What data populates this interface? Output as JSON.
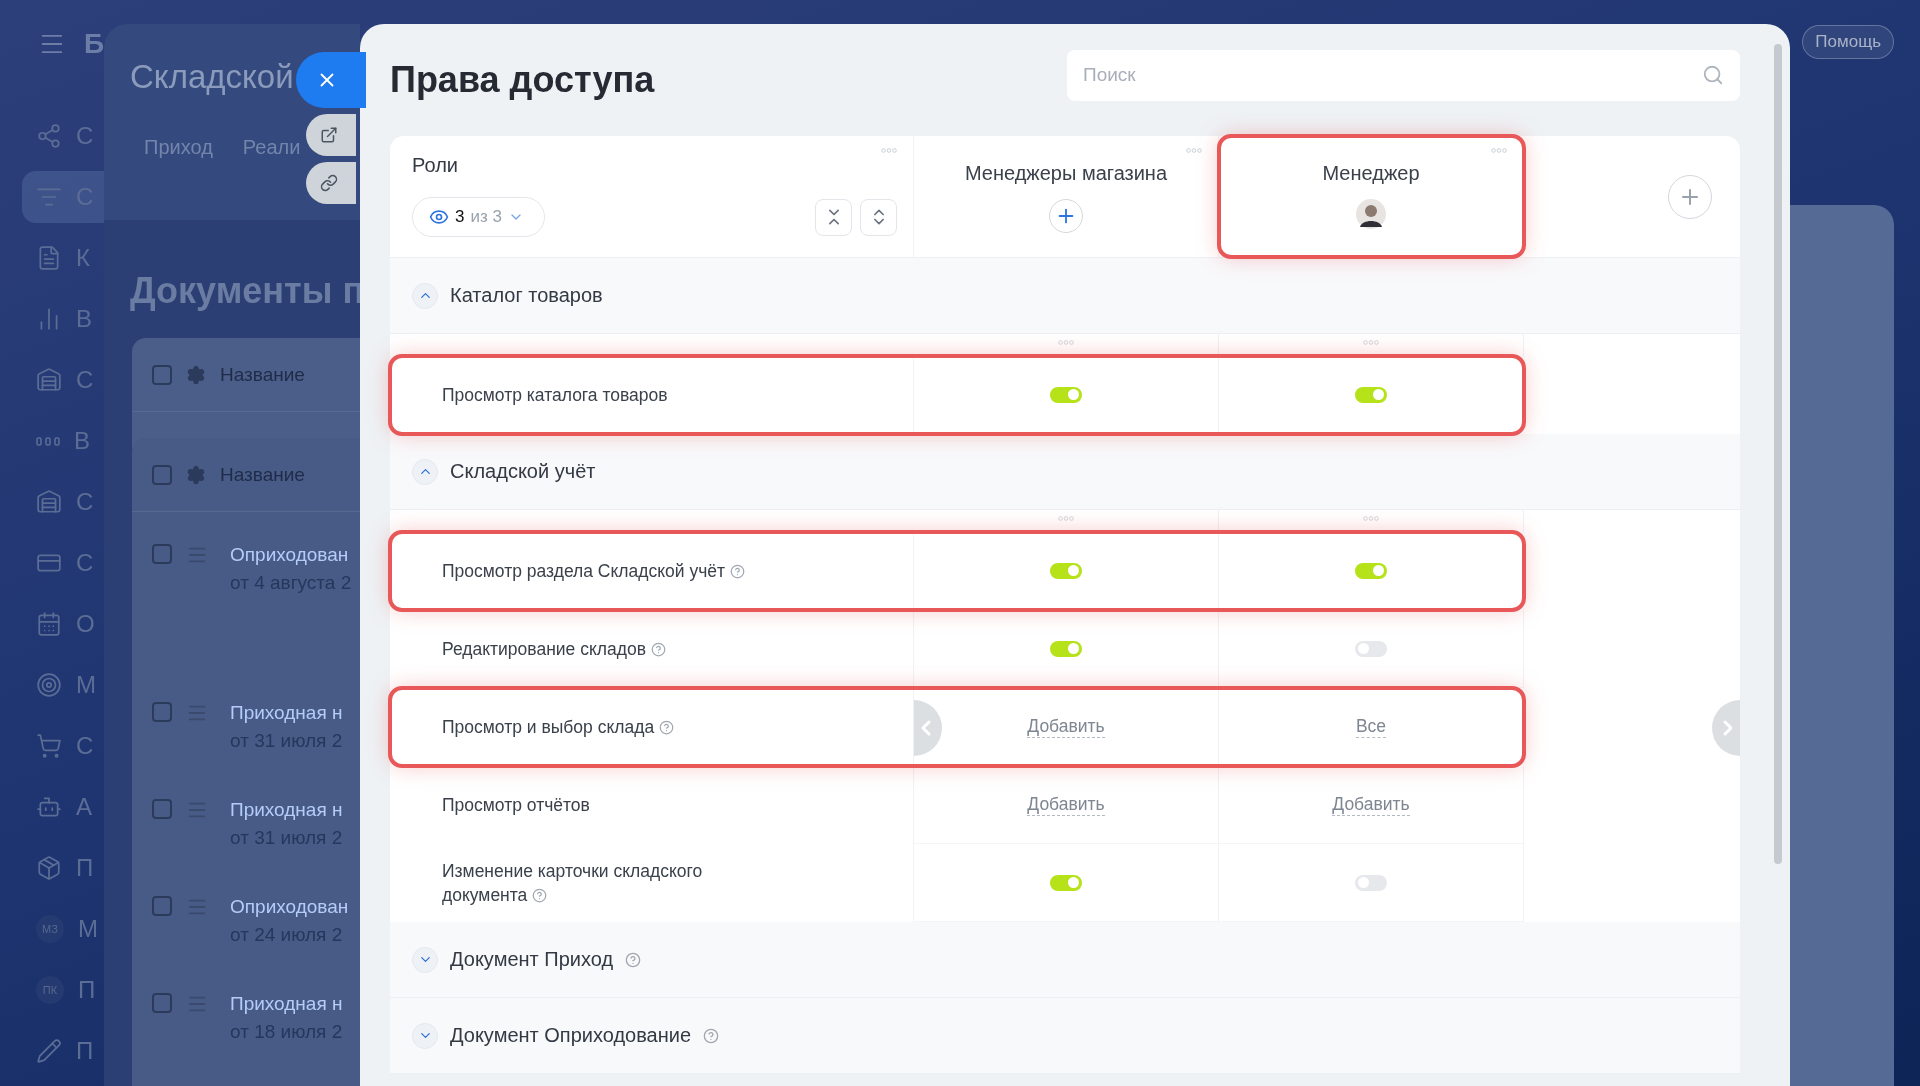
{
  "sidebar": {
    "brand": "Б",
    "items": [
      {
        "kind": "share",
        "label": "С",
        "selected": false
      },
      {
        "kind": "filter",
        "label": "С",
        "selected": true
      },
      {
        "kind": "doc",
        "label": "К",
        "selected": false
      },
      {
        "kind": "chart",
        "label": "В",
        "selected": false
      },
      {
        "kind": "warehouse",
        "label": "С",
        "selected": false
      },
      {
        "kind": "dots",
        "label": "В",
        "selected": false
      },
      {
        "kind": "warehouse",
        "label": "С",
        "selected": false
      },
      {
        "kind": "card",
        "label": "С",
        "selected": false
      },
      {
        "kind": "calendar",
        "label": "О",
        "selected": false
      },
      {
        "kind": "target",
        "label": "М",
        "selected": false
      },
      {
        "kind": "cart",
        "label": "С",
        "selected": false
      },
      {
        "kind": "robot",
        "label": "А",
        "selected": false
      },
      {
        "kind": "box",
        "label": "П",
        "selected": false
      },
      {
        "kind": "avatar",
        "initials": "МЗ",
        "label": "М",
        "selected": false
      },
      {
        "kind": "avatar",
        "initials": "ПК",
        "label": "П",
        "selected": false
      },
      {
        "kind": "pencil",
        "label": "П",
        "selected": false
      }
    ]
  },
  "background_panel": {
    "title": "Складской",
    "tabs": [
      "Приход",
      "Реали"
    ],
    "heading": "Документы п",
    "tables": [
      {
        "header": "Название",
        "all_checked": false
      },
      {
        "header": "Название",
        "all_checked": false,
        "rows": [
          {
            "title": "Оприходован",
            "date": "от 4 августа 2",
            "checked": false
          },
          {
            "title": "Приходная н",
            "date": "от 31 июля 2",
            "checked": false
          },
          {
            "title": "Приходная н",
            "date": "от 31 июля 2",
            "checked": false
          },
          {
            "title": "Оприходован",
            "date": "от 24 июля 2",
            "checked": false
          },
          {
            "title": "Приходная н",
            "date": "от 18 июля 2",
            "checked": false
          }
        ]
      }
    ]
  },
  "help_button": "Помощь",
  "modal": {
    "title": "Права доступа",
    "search": {
      "placeholder": "Поиск"
    },
    "roles_column": {
      "label": "Роли",
      "shown": "3",
      "total": "из 3"
    },
    "columns": [
      {
        "title": "Менеджеры магазина",
        "kind": "add",
        "highlighted": false
      },
      {
        "title": "Менеджер",
        "kind": "avatar",
        "highlighted": true
      }
    ],
    "sections": [
      {
        "title": "Каталог товаров",
        "expanded": true,
        "hint": false,
        "rows": [
          {
            "label": "Просмотр каталога товаров",
            "hint": false,
            "highlighted": true,
            "cells": [
              {
                "kind": "toggle",
                "on": true
              },
              {
                "kind": "toggle",
                "on": true
              }
            ]
          }
        ]
      },
      {
        "title": "Складской учёт",
        "expanded": true,
        "hint": false,
        "rows": [
          {
            "label": "Просмотр раздела Складской учёт",
            "hint": true,
            "highlighted": true,
            "cells": [
              {
                "kind": "toggle",
                "on": true
              },
              {
                "kind": "toggle",
                "on": true
              }
            ]
          },
          {
            "label": "Редактирование складов",
            "hint": true,
            "highlighted": false,
            "cells": [
              {
                "kind": "toggle",
                "on": true
              },
              {
                "kind": "toggle",
                "on": false
              }
            ]
          },
          {
            "label": "Просмотр и выбор склада",
            "hint": true,
            "highlighted": true,
            "cells": [
              {
                "kind": "link",
                "text": "Добавить"
              },
              {
                "kind": "link",
                "text": "Все"
              }
            ]
          },
          {
            "label": "Просмотр отчётов",
            "hint": false,
            "highlighted": false,
            "cells": [
              {
                "kind": "link",
                "text": "Добавить"
              },
              {
                "kind": "link",
                "text": "Добавить"
              }
            ]
          },
          {
            "label": "Изменение карточки складского документа",
            "hint": true,
            "highlighted": false,
            "cells": [
              {
                "kind": "toggle",
                "on": true
              },
              {
                "kind": "toggle",
                "on": false
              }
            ]
          }
        ]
      },
      {
        "title": "Документ Приход",
        "expanded": false,
        "hint": true
      },
      {
        "title": "Документ Оприходование",
        "expanded": false,
        "hint": true
      }
    ]
  }
}
